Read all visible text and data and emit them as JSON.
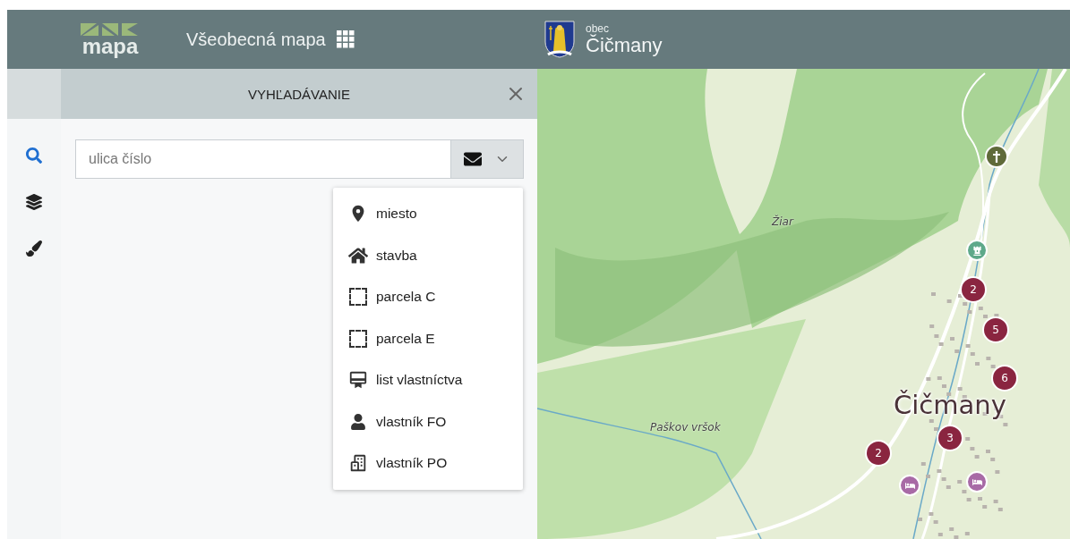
{
  "header": {
    "logo_text": "mapa",
    "app_title": "Všeobecná mapa",
    "municipality_prefix": "obec",
    "municipality_name": "Čičmany"
  },
  "panel": {
    "title": "VYHĽADÁVANIE"
  },
  "rail": [
    {
      "kind": "search",
      "selected": true
    },
    {
      "kind": "layers",
      "selected": false
    },
    {
      "kind": "draw",
      "selected": false
    }
  ],
  "search": {
    "placeholder": "ulica číslo"
  },
  "dropdown": [
    {
      "kind": "place",
      "label": "miesto"
    },
    {
      "kind": "building",
      "label": "stavba"
    },
    {
      "kind": "parcel_c",
      "label": "parcela C"
    },
    {
      "kind": "parcel_e",
      "label": "parcela E"
    },
    {
      "kind": "deed",
      "label": "list vlastníctva"
    },
    {
      "kind": "person",
      "label": "vlastník FO"
    },
    {
      "kind": "company",
      "label": "vlastník PO"
    }
  ],
  "map": {
    "labels": [
      {
        "kind": "hill",
        "text": "Žiar"
      },
      {
        "kind": "hill",
        "text": "Paškov vršok"
      },
      {
        "kind": "town",
        "text": "Čičmany"
      }
    ],
    "markers": [
      {
        "kind": "church"
      },
      {
        "kind": "castle"
      },
      {
        "kind": "cluster",
        "count": "2"
      },
      {
        "kind": "cluster",
        "count": "5"
      },
      {
        "kind": "cluster",
        "count": "6"
      },
      {
        "kind": "cluster",
        "count": "3"
      },
      {
        "kind": "cluster",
        "count": "2"
      },
      {
        "kind": "hotel"
      },
      {
        "kind": "hotel"
      }
    ]
  }
}
